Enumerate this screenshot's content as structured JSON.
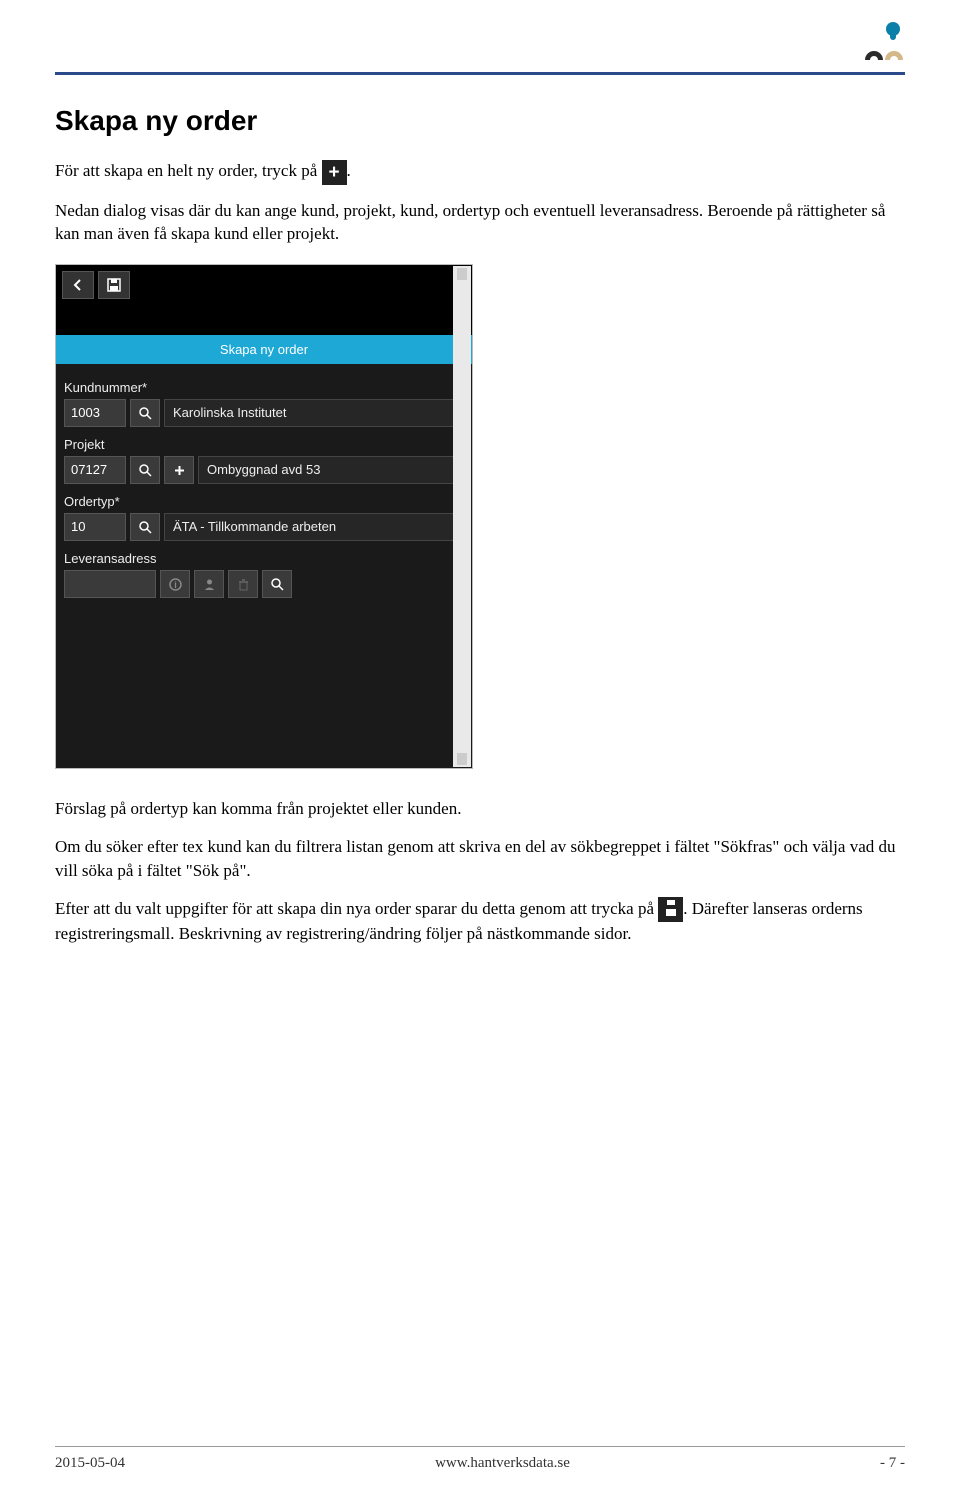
{
  "heading": "Skapa ny order",
  "para1_pre": "För att skapa en helt ny order, tryck på ",
  "para1_post": ".",
  "para2": "Nedan dialog visas där du kan ange kund, projekt, kund, ordertyp och eventuell leveransadress. Beroende på rättigheter så kan man även få skapa kund eller projekt.",
  "screenshot": {
    "title": "Skapa ny order",
    "kundnummer_label": "Kundnummer*",
    "kundnummer_value": "1003",
    "kundnummer_text": "Karolinska Institutet",
    "projekt_label": "Projekt",
    "projekt_value": "07127",
    "projekt_text": "Ombyggnad avd 53",
    "ordertyp_label": "Ordertyp*",
    "ordertyp_value": "10",
    "ordertyp_text": "ÄTA - Tillkommande arbeten",
    "leverans_label": "Leveransadress"
  },
  "para3": "Förslag på ordertyp kan komma från projektet eller kunden.",
  "para4": "Om du söker efter tex kund kan du filtrera listan genom att skriva en del av sökbegreppet i fältet \"Sökfras\" och välja vad du vill söka på i fältet \"Sök på\".",
  "para5_pre": "Efter att du valt uppgifter för att skapa din nya order sparar du detta genom att trycka på ",
  "para5_post": ". Därefter lanseras orderns registreringsmall. Beskrivning av registrering/ändring följer på nästkommande sidor.",
  "footer": {
    "date": "2015-05-04",
    "url": "www.hantverksdata.se",
    "page": "- 7 -"
  }
}
